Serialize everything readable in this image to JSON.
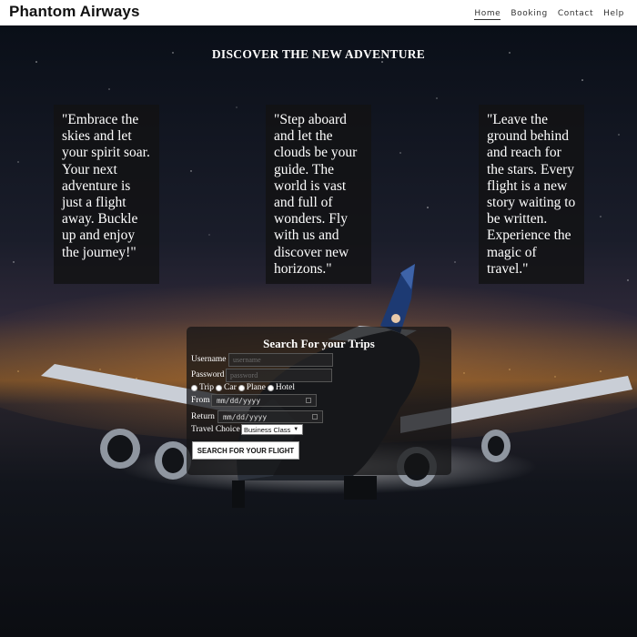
{
  "header": {
    "brand": "Phantom Airways",
    "nav": [
      {
        "label": "Home",
        "active": true
      },
      {
        "label": "Booking",
        "active": false
      },
      {
        "label": "Contact",
        "active": false
      },
      {
        "label": "Help",
        "active": false
      }
    ]
  },
  "hero": {
    "title": "DISCOVER THE NEW ADVENTURE",
    "quotes": [
      "\"Embrace the skies and let your spirit soar. Your next adventure is just a flight away. Buckle up and enjoy the journey!\"",
      "\"Step aboard and let the clouds be your guide. The world is vast and full of wonders. Fly with us and discover new horizons.\"",
      "\"Leave the ground behind and reach for the stars. Every flight is a new story waiting to be written. Experience the magic of travel.\""
    ]
  },
  "form": {
    "title": "Search For your Trips",
    "username_label": "Username",
    "username_placeholder": "username",
    "password_label": "Password",
    "password_placeholder": "password",
    "options": [
      "Trip",
      "Car",
      "Plane",
      "Hotel"
    ],
    "from_label": "From",
    "from_value": "mm/dd/yyyy",
    "return_label": "Return",
    "return_value": "mm/dd/yyyy",
    "travel_choice_label": "Travel Choice",
    "travel_choice_value": "Business Class",
    "search_button": "SEARCH FOR YOUR FLIGHT"
  },
  "colors": {
    "header_bg": "#ffffff",
    "panel_bg": "#121214",
    "text": "#ffffff"
  }
}
